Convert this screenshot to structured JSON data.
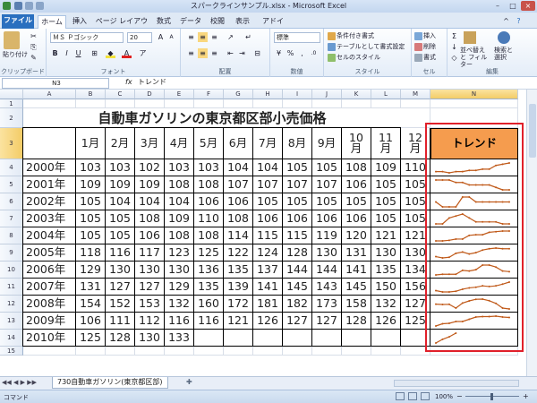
{
  "window": {
    "title": "スパークラインサンプル.xlsx - Microsoft Excel"
  },
  "tabs": [
    "ファイル",
    "ホーム",
    "挿入",
    "ページ レイアウト",
    "数式",
    "データ",
    "校閲",
    "表示",
    "アドイン"
  ],
  "ribbon": {
    "clipboard": {
      "paste": "貼り付け",
      "label": "クリップボード"
    },
    "font": {
      "name": "ＭＳ Ｐゴシック",
      "size": "20",
      "label": "フォント"
    },
    "alignment": {
      "label": "配置"
    },
    "number": {
      "format": "標準",
      "label": "数値"
    },
    "styles": {
      "items": [
        "条件付き書式",
        "テーブルとして書式設定",
        "セルのスタイル"
      ],
      "label": "スタイル"
    },
    "cells": {
      "items": [
        "挿入",
        "削除",
        "書式"
      ],
      "label": "セル"
    },
    "editing": {
      "sort": "並べ替えと フィルター",
      "find": "検索と 選択",
      "label": "編集"
    }
  },
  "formula_bar": {
    "name_box": "N3",
    "fx": "fx",
    "content": "トレンド"
  },
  "columns": [
    "A",
    "B",
    "C",
    "D",
    "E",
    "F",
    "G",
    "H",
    "I",
    "J",
    "K",
    "L",
    "M",
    "N"
  ],
  "rows": [
    "1",
    "2",
    "3",
    "4",
    "5",
    "6",
    "7",
    "8",
    "9",
    "10",
    "11",
    "12",
    "13",
    "14",
    "15"
  ],
  "sheet": {
    "title": "自動車ガソリンの東京都区部小売価格",
    "months": [
      "1月",
      "2月",
      "3月",
      "4月",
      "5月",
      "6月",
      "7月",
      "8月",
      "9月",
      "10 月",
      "11 月",
      "12 月"
    ],
    "trend_header": "トレンド",
    "years": [
      "2000年",
      "2001年",
      "2002年",
      "2003年",
      "2004年",
      "2005年",
      "2006年",
      "2007年",
      "2008年",
      "2009年",
      "2010年"
    ],
    "data": [
      [
        103,
        103,
        102,
        103,
        103,
        104,
        104,
        105,
        105,
        108,
        109,
        110
      ],
      [
        109,
        109,
        109,
        108,
        108,
        107,
        107,
        107,
        107,
        106,
        105,
        105
      ],
      [
        105,
        104,
        104,
        104,
        106,
        106,
        105,
        105,
        105,
        105,
        105,
        105
      ],
      [
        105,
        105,
        108,
        109,
        110,
        108,
        106,
        106,
        106,
        106,
        105,
        105
      ],
      [
        105,
        105,
        106,
        108,
        108,
        114,
        115,
        115,
        119,
        120,
        121,
        121
      ],
      [
        118,
        116,
        117,
        123,
        125,
        122,
        124,
        128,
        130,
        131,
        130,
        130
      ],
      [
        129,
        130,
        130,
        130,
        136,
        135,
        137,
        144,
        144,
        141,
        135,
        134
      ],
      [
        131,
        127,
        127,
        129,
        135,
        139,
        141,
        145,
        143,
        145,
        150,
        156
      ],
      [
        154,
        152,
        153,
        132,
        160,
        172,
        181,
        182,
        173,
        158,
        132,
        127
      ],
      [
        106,
        111,
        112,
        116,
        116,
        121,
        126,
        127,
        127,
        128,
        126,
        125
      ],
      [
        125,
        128,
        130,
        133
      ]
    ],
    "sparkline_color": "#c05a1a",
    "highlight_color": "#e0202a",
    "header_fill": "#f59c4e"
  },
  "sheet_tabs": {
    "active": "730自動車ガソリン(東京都区部)"
  },
  "status": {
    "mode": "コマンド",
    "zoom": "100%"
  }
}
